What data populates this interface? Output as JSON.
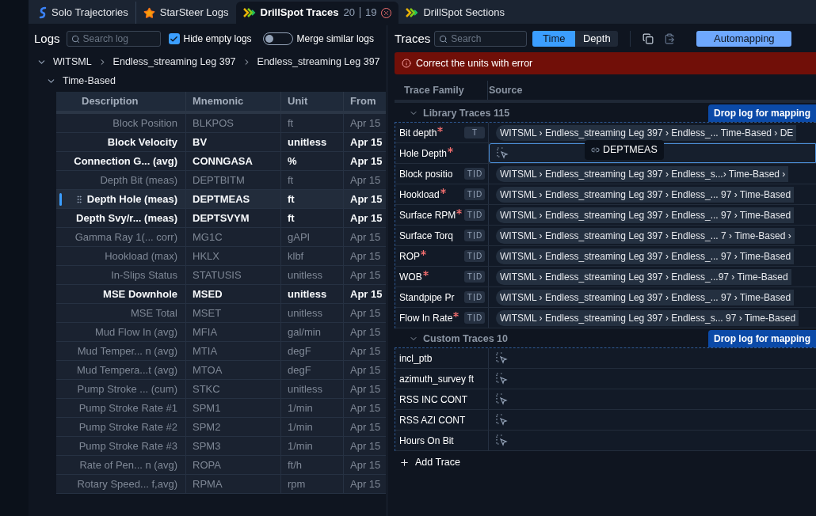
{
  "tabs": [
    {
      "kind": "trajectories",
      "label": "Solo Trajectories",
      "selected": false
    },
    {
      "kind": "star",
      "label": "StarSteer Logs",
      "selected": false
    },
    {
      "kind": "drillspot",
      "label": "DrillSpot Traces",
      "count_a": "20",
      "count_b": "19",
      "closable": true,
      "selected": true
    },
    {
      "kind": "drillspot",
      "label": "DrillSpot Sections",
      "selected": false
    }
  ],
  "logs": {
    "title": "Logs",
    "search_placeholder": "Search log",
    "hide_empty": {
      "label": "Hide empty logs",
      "checked": true
    },
    "merge_similar": {
      "label": "Merge similar logs",
      "on": false
    },
    "tree": {
      "path": [
        "WITSML",
        "Endless_streaming Leg 397",
        "Endless_streaming Leg 397"
      ],
      "expanded": true,
      "children": [
        {
          "label": "Time-Based",
          "expanded": true
        }
      ]
    },
    "table": {
      "columns": [
        "Description",
        "Mnemonic",
        "Unit",
        "From"
      ],
      "rows": [
        {
          "description": "Block Position",
          "mnemonic": "BLKPOS",
          "unit": "ft",
          "from": "Apr 15",
          "active": false,
          "selected": false
        },
        {
          "description": "Block Velocity",
          "mnemonic": "BV",
          "unit": "unitless",
          "from": "Apr 15",
          "active": true,
          "selected": false
        },
        {
          "description": "Connection G... (avg)",
          "mnemonic": "CONNGASA",
          "unit": "%",
          "from": "Apr 15",
          "active": true,
          "selected": false
        },
        {
          "description": "Depth Bit (meas)",
          "mnemonic": "DEPTBITM",
          "unit": "ft",
          "from": "Apr 15",
          "active": false,
          "selected": false
        },
        {
          "description": "Depth Hole (meas)",
          "mnemonic": "DEPTMEAS",
          "unit": "ft",
          "from": "Apr 15",
          "active": true,
          "selected": true
        },
        {
          "description": "Depth Svy/r... (meas)",
          "mnemonic": "DEPTSVYM",
          "unit": "ft",
          "from": "Apr 15",
          "active": true,
          "selected": false
        },
        {
          "description": "Gamma Ray 1(... corr)",
          "mnemonic": "MG1C",
          "unit": "gAPI",
          "from": "Apr 15",
          "active": false,
          "selected": false
        },
        {
          "description": "Hookload (max)",
          "mnemonic": "HKLX",
          "unit": "klbf",
          "from": "Apr 15",
          "active": false,
          "selected": false
        },
        {
          "description": "In-Slips Status",
          "mnemonic": "STATUSIS",
          "unit": "unitless",
          "from": "Apr 15",
          "active": false,
          "selected": false
        },
        {
          "description": "MSE Downhole",
          "mnemonic": "MSED",
          "unit": "unitless",
          "from": "Apr 15",
          "active": true,
          "selected": false
        },
        {
          "description": "MSE Total",
          "mnemonic": "MSET",
          "unit": "unitless",
          "from": "Apr 15",
          "active": false,
          "selected": false
        },
        {
          "description": "Mud Flow In (avg)",
          "mnemonic": "MFIA",
          "unit": "gal/min",
          "from": "Apr 15",
          "active": false,
          "selected": false
        },
        {
          "description": "Mud Temper... n (avg)",
          "mnemonic": "MTIA",
          "unit": "degF",
          "from": "Apr 15",
          "active": false,
          "selected": false
        },
        {
          "description": "Mud Tempera...t (avg)",
          "mnemonic": "MTOA",
          "unit": "degF",
          "from": "Apr 15",
          "active": false,
          "selected": false
        },
        {
          "description": "Pump Stroke ... (cum)",
          "mnemonic": "STKC",
          "unit": "unitless",
          "from": "Apr 15",
          "active": false,
          "selected": false
        },
        {
          "description": "Pump Stroke Rate #1",
          "mnemonic": "SPM1",
          "unit": "1/min",
          "from": "Apr 15",
          "active": false,
          "selected": false
        },
        {
          "description": "Pump Stroke Rate #2",
          "mnemonic": "SPM2",
          "unit": "1/min",
          "from": "Apr 15",
          "active": false,
          "selected": false
        },
        {
          "description": "Pump Stroke Rate #3",
          "mnemonic": "SPM3",
          "unit": "1/min",
          "from": "Apr 15",
          "active": false,
          "selected": false
        },
        {
          "description": "Rate of Pen... n (avg)",
          "mnemonic": "ROPA",
          "unit": "ft/h",
          "from": "Apr 15",
          "active": false,
          "selected": false
        },
        {
          "description": "Rotary Speed... f,avg)",
          "mnemonic": "RPMA",
          "unit": "rpm",
          "from": "Apr 15",
          "active": false,
          "selected": false
        }
      ]
    }
  },
  "traces": {
    "title": "Traces",
    "search_placeholder": "Search",
    "modes": [
      {
        "label": "Time",
        "selected": true
      },
      {
        "label": "Depth",
        "selected": false
      }
    ],
    "automapping": "Automapping",
    "error": "Correct the units with error",
    "columns": [
      "Trace Family",
      "Source"
    ],
    "sections": [
      {
        "title": "Library Traces 115",
        "expanded": true,
        "drop_hint": "Drop log for mapping",
        "rows": [
          {
            "name": "Bit depth",
            "required": true,
            "badges": [
              "T"
            ],
            "kind": "mapped",
            "source": "WITSML › Endless_streaming Leg 397 › Endless_... Time-Based › DE"
          },
          {
            "name": "Hole Depth",
            "required": true,
            "kind": "dropping",
            "tooltip": "DEPTMEAS"
          },
          {
            "name": "Block positio",
            "required": false,
            "badges": [
              "T",
              "D"
            ],
            "kind": "mapped",
            "source": "WITSML › Endless_streaming Leg 397 › Endless_s...› Time-Based ›"
          },
          {
            "name": "Hookload",
            "required": true,
            "badges": [
              "T",
              "D"
            ],
            "kind": "mapped",
            "source": "WITSML › Endless_streaming Leg 397 › Endless_... 97 › Time-Based"
          },
          {
            "name": "Surface RPM",
            "required": true,
            "badges": [
              "T",
              "D"
            ],
            "kind": "mapped",
            "source": "WITSML › Endless_streaming Leg 397 › Endless_... 97 › Time-Based"
          },
          {
            "name": "Surface Torq",
            "required": false,
            "badges": [
              "T",
              "D"
            ],
            "kind": "mapped",
            "source": "WITSML › Endless_streaming Leg 397 › Endless_... 7 › Time-Based ›"
          },
          {
            "name": "ROP",
            "required": true,
            "badges": [
              "T",
              "D"
            ],
            "kind": "mapped",
            "source": "WITSML › Endless_streaming Leg 397 › Endless_... 97 › Time-Based"
          },
          {
            "name": "WOB",
            "required": true,
            "badges": [
              "T",
              "D"
            ],
            "kind": "mapped",
            "source": "WITSML › Endless_streaming Leg 397 › Endless_...97 › Time-Based"
          },
          {
            "name": "Standpipe Pr",
            "required": false,
            "badges": [
              "T",
              "D"
            ],
            "kind": "mapped",
            "source": "WITSML › Endless_streaming Leg 397 › Endless_... 97 › Time-Based"
          },
          {
            "name": "Flow In Rate",
            "required": true,
            "badges": [
              "T",
              "D"
            ],
            "kind": "mapped",
            "source": "WITSML › Endless_streaming Leg 397 › Endless_s... 97 › Time-Based"
          }
        ]
      },
      {
        "title": "Custom Traces 10",
        "expanded": true,
        "drop_hint": "Drop log for mapping",
        "rows": [
          {
            "name": "incl_ptb",
            "required": false,
            "kind": "empty"
          },
          {
            "name": "azimuth_survey ft",
            "required": false,
            "kind": "empty"
          },
          {
            "name": "RSS INC CONT",
            "required": false,
            "kind": "empty"
          },
          {
            "name": "RSS AZI CONT",
            "required": false,
            "kind": "empty"
          },
          {
            "name": "Hours On Bit",
            "required": false,
            "kind": "empty"
          }
        ]
      }
    ],
    "add_trace": "Add Trace"
  }
}
